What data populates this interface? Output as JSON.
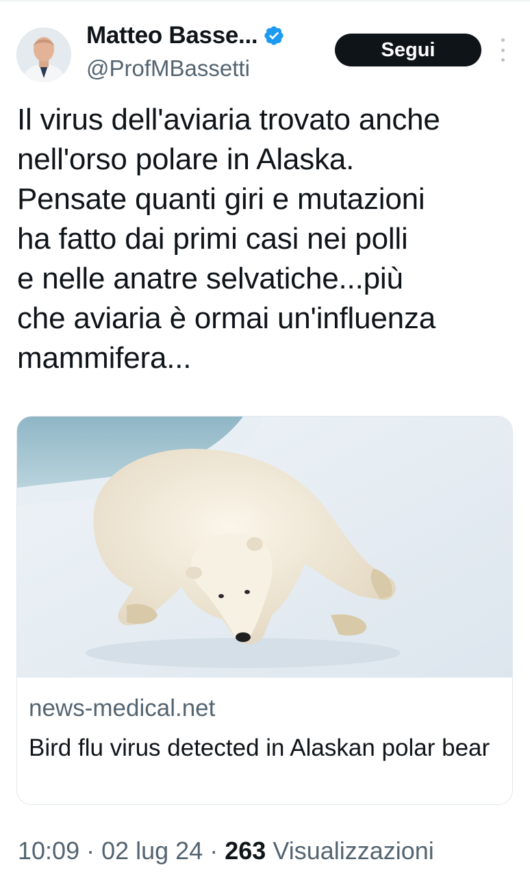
{
  "author": {
    "name": "Matteo Basse...",
    "handle": "@ProfMBassetti",
    "verified": true
  },
  "follow_label": "Segui",
  "tweet": {
    "text": "Il virus dell'aviaria trovato anche\nnell'orso polare in Alaska.\nPensate quanti giri e mutazioni\nha fatto dai primi casi nei polli\ne nelle anatre selvatiche...più\nche aviaria è ormai un'influenza\nmammifera..."
  },
  "card": {
    "domain": "news-medical.net",
    "title": "Bird flu virus detected in Alaskan polar bear",
    "image": "polar-bear-on-snow"
  },
  "meta": {
    "time": "10:09",
    "date": "02 lug 24",
    "views_count": "263",
    "views_label": "Visualizzazioni"
  },
  "colors": {
    "verified_blue": "#1d9bf0",
    "follow_bg": "#0f1419",
    "secondary_text": "#536471"
  }
}
